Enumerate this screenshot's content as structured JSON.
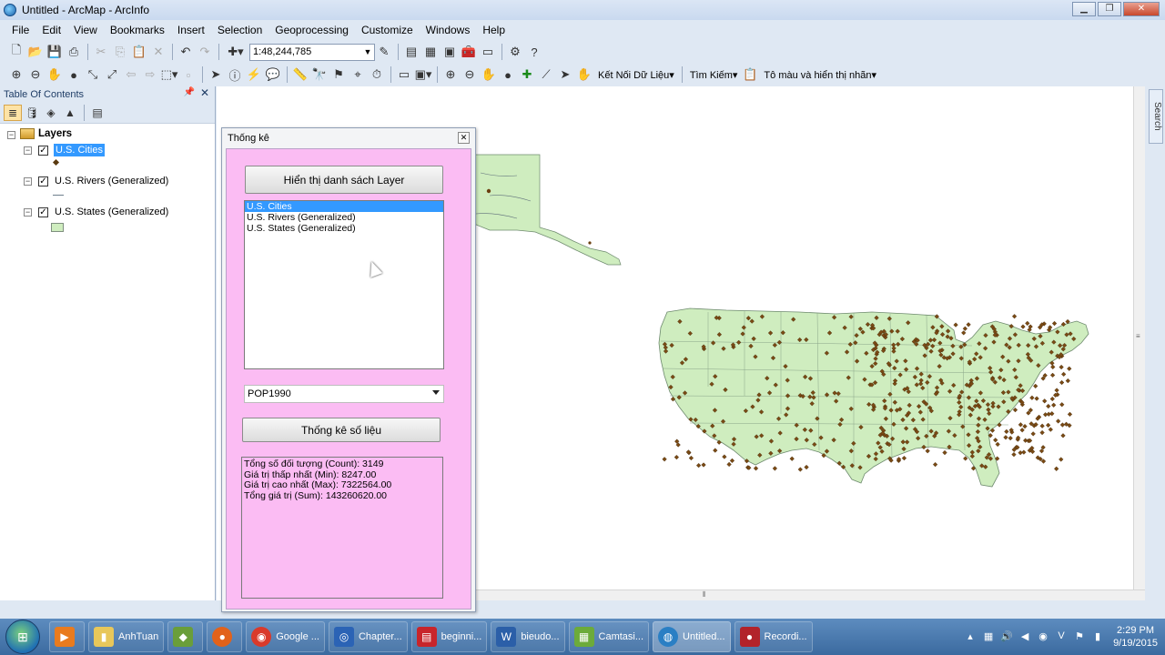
{
  "window": {
    "title": "Untitled - ArcMap - ArcInfo"
  },
  "menu": [
    "File",
    "Edit",
    "View",
    "Bookmarks",
    "Insert",
    "Selection",
    "Geoprocessing",
    "Customize",
    "Windows",
    "Help"
  ],
  "toolbar": {
    "scale": "1:48,244,785",
    "ket_noi": "Kết Nối Dữ Liệu",
    "tim_kiem": "Tìm Kiếm",
    "to_mau": "Tô màu và hiển thị nhãn"
  },
  "toc": {
    "title": "Table Of Contents",
    "root": "Layers",
    "layers": [
      {
        "name": "U.S. Cities",
        "selected": true
      },
      {
        "name": "U.S. Rivers (Generalized)",
        "selected": false
      },
      {
        "name": "U.S. States (Generalized)",
        "selected": false
      }
    ]
  },
  "search_tab": "Search",
  "dialog": {
    "title": "Thống kê",
    "show_layers_button": "Hiển thị danh sách Layer",
    "layer_list": [
      "U.S. Cities",
      "U.S. Rivers (Generalized)",
      "U.S. States (Generalized)"
    ],
    "field_select": "POP1990",
    "stats_button": "Thống kê số liệu",
    "results": [
      "Tổng số đối tượng (Count): 3149",
      "Giá trị thấp nhất (Min): 8247.00",
      "Giá trị cao nhất (Max): 7322564.00",
      "Tổng giá trị (Sum): 143260620.00"
    ]
  },
  "taskbar": {
    "items": [
      "AnhTuan",
      "Google ...",
      "Chapter...",
      "beginni...",
      "bieudo...",
      "Camtasi...",
      "Untitled...",
      "Recordi..."
    ],
    "time": "2:29 PM",
    "date": "9/19/2015"
  },
  "colors": {
    "map_fill": "#cfedbf",
    "dialog_bg": "#fbbcf3",
    "selection": "#3399ff",
    "city_marker": "#7a4a14"
  }
}
